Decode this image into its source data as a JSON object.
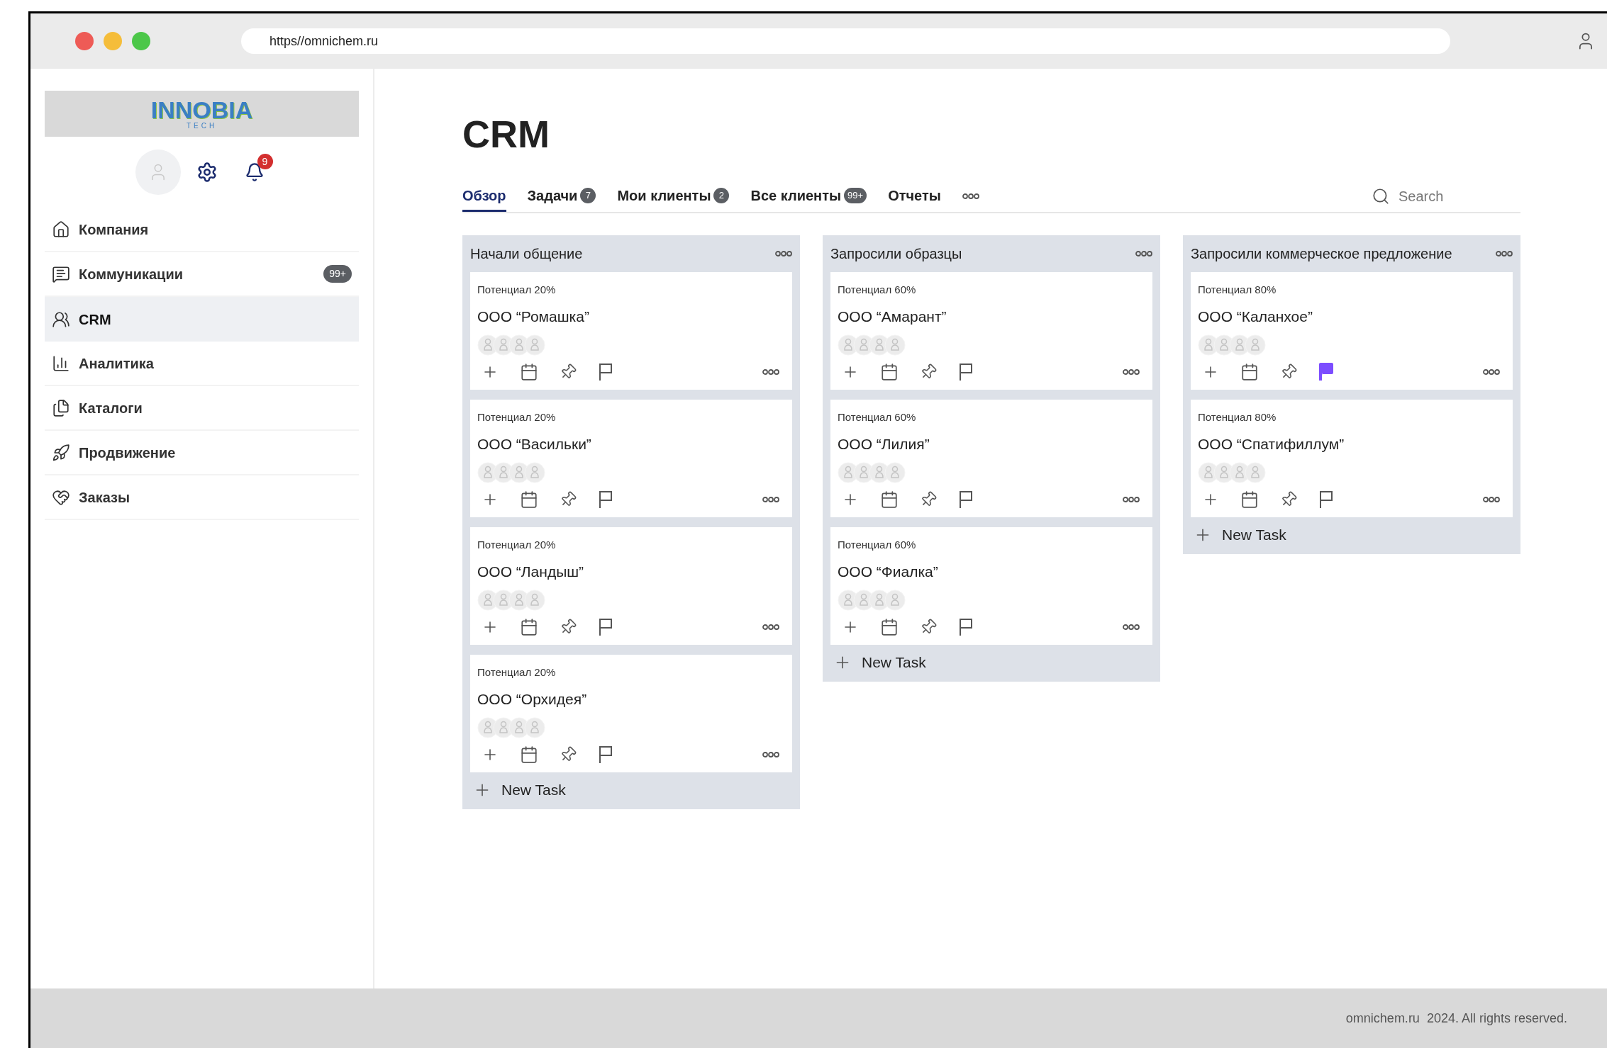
{
  "browser": {
    "url": "https//omnichem.ru"
  },
  "sidebar": {
    "logo": {
      "name": "INNOBIA",
      "sub": "TECH"
    },
    "notifications": "9",
    "nav": [
      {
        "label": "Компания",
        "selected": false
      },
      {
        "label": "Коммуникации",
        "badge": "99+",
        "selected": false
      },
      {
        "label": "CRM",
        "selected": true
      },
      {
        "label": "Аналитика",
        "selected": false
      },
      {
        "label": "Каталоги",
        "selected": false
      },
      {
        "label": "Продвижение",
        "selected": false
      },
      {
        "label": "Заказы",
        "selected": false
      }
    ]
  },
  "page": {
    "title": "CRM"
  },
  "tabs": [
    {
      "label": "Обзор",
      "selected": true
    },
    {
      "label": "Задачи",
      "count": "7",
      "selected": false
    },
    {
      "label": "Мои клиенты",
      "count": "2",
      "selected": false
    },
    {
      "label": "Все клиенты",
      "count": "99+",
      "selected": false
    },
    {
      "label": "Отчеты",
      "selected": false
    }
  ],
  "search": {
    "placeholder": "Search"
  },
  "columns": [
    {
      "title": "Начали общение",
      "new_task": "New Task",
      "cards": [
        {
          "potential": "Потенциал 20%",
          "name": "ООО “Ромашка”",
          "flagged": false
        },
        {
          "potential": "Потенциал 20%",
          "name": "ООО “Васильки”",
          "flagged": false
        },
        {
          "potential": "Потенциал 20%",
          "name": "ООО “Ландыш”",
          "flagged": false
        },
        {
          "potential": "Потенциал 20%",
          "name": "ООО “Орхидея”",
          "flagged": false
        }
      ]
    },
    {
      "title": "Запросили образцы",
      "new_task": "New Task",
      "cards": [
        {
          "potential": "Потенциал 60%",
          "name": "ООО “Амарант”",
          "flagged": false
        },
        {
          "potential": "Потенциал 60%",
          "name": "ООО “Лилия”",
          "flagged": false
        },
        {
          "potential": "Потенциал 60%",
          "name": "ООО “Фиалка”",
          "flagged": false
        }
      ]
    },
    {
      "title": "Запросили коммерческое предложение",
      "new_task": "New Task",
      "cards": [
        {
          "potential": "Потенциал 80%",
          "name": "ООО “Каланхое”",
          "flagged": true
        },
        {
          "potential": "Потенциал 80%",
          "name": "ООО “Спатифиллум”",
          "flagged": false
        }
      ]
    }
  ],
  "footer": {
    "text": "omnichem.ru  2024. All rights reserved."
  }
}
